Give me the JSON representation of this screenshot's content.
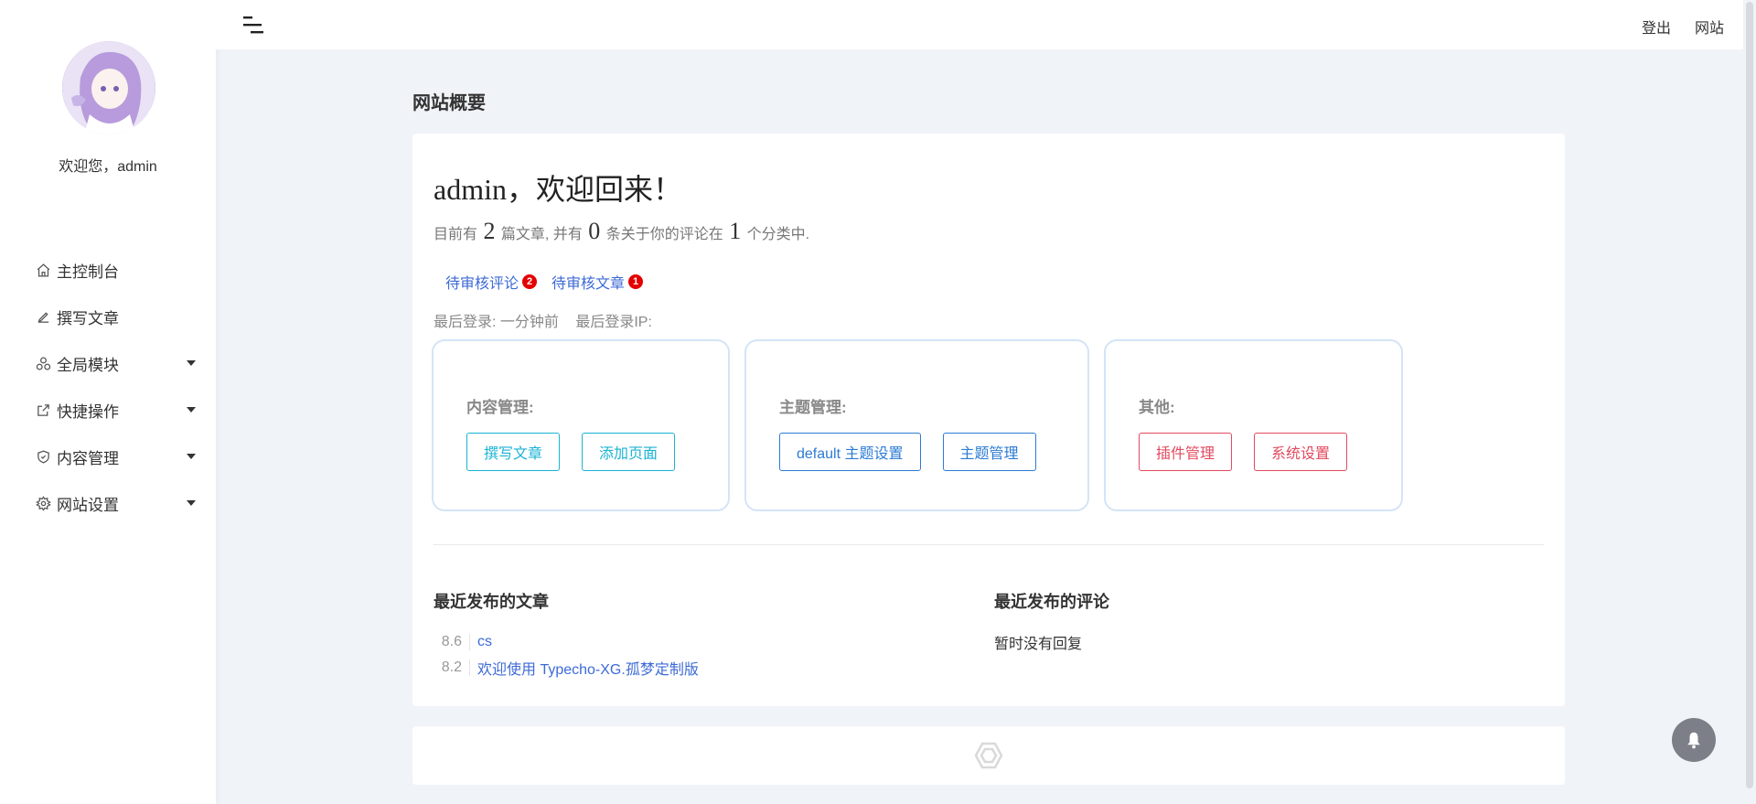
{
  "sidebar": {
    "welcome": "欢迎您，admin",
    "items": [
      {
        "label": "主控制台",
        "icon": "home-icon",
        "has_submenu": false
      },
      {
        "label": "撰写文章",
        "icon": "edit-icon",
        "has_submenu": false
      },
      {
        "label": "全局模块",
        "icon": "modules-icon",
        "has_submenu": true
      },
      {
        "label": "快捷操作",
        "icon": "external-link-icon",
        "has_submenu": true
      },
      {
        "label": "内容管理",
        "icon": "shield-icon",
        "has_submenu": true
      },
      {
        "label": "网站设置",
        "icon": "gear-icon",
        "has_submenu": true
      }
    ]
  },
  "topbar": {
    "logout": "登出",
    "website": "网站"
  },
  "page": {
    "title": "网站概要"
  },
  "dashboard": {
    "greeting": "admin，欢迎回来！",
    "stats": {
      "prefix": "目前有",
      "post_count": "2",
      "mid1": "篇文章, 并有",
      "comment_count": "0",
      "mid2": "条关于你的评论在",
      "category_count": "1",
      "suffix": "个分类中."
    },
    "pending": {
      "comments_label": "待审核评论",
      "comments_count": "2",
      "posts_label": "待审核文章",
      "posts_count": "1"
    },
    "last_login": {
      "time": "最后登录: 一分钟前",
      "ip": "最后登录IP:"
    },
    "boxes": {
      "content": {
        "title": "内容管理:",
        "btn1": "撰写文章",
        "btn2": "添加页面"
      },
      "theme": {
        "title": "主题管理:",
        "btn1": "default 主题设置",
        "btn2": "主题管理"
      },
      "other": {
        "title": "其他:",
        "btn1": "插件管理",
        "btn2": "系统设置"
      }
    },
    "recent_posts": {
      "title": "最近发布的文章",
      "items": [
        {
          "date": "8.6",
          "title": "cs"
        },
        {
          "date": "8.2",
          "title": "欢迎使用 Typecho-XG.孤梦定制版"
        }
      ]
    },
    "recent_comments": {
      "title": "最近发布的评论",
      "empty": "暂时没有回复"
    }
  },
  "colors": {
    "link": "#3d6ad6",
    "info": "#1bb3d4",
    "primary": "#2c7bd4",
    "danger": "#e24a5e",
    "badge": "#e40000"
  }
}
